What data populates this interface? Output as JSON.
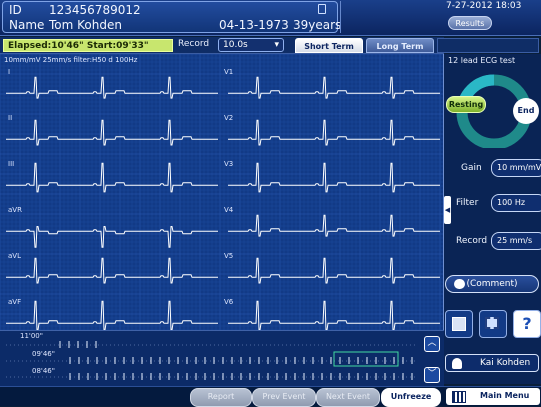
{
  "patient": {
    "id_label": "ID",
    "id_value": "123456789012",
    "name_label": "Name",
    "name_value": "Tom Kohden",
    "dob": "04-13-1973",
    "age": "39years"
  },
  "topbar": {
    "datetime": "7-27-2012 18:03",
    "results_label": "Results"
  },
  "status": {
    "elapsed_text": "Elapsed:10'46\"   Start:09'33\"",
    "record_label": "Record",
    "record_value": "10.0s"
  },
  "tabs": {
    "short_term": "Short Term",
    "long_term": "Long Term"
  },
  "ecg": {
    "settings_text": "10mm/mV 25mm/s filter:H50 d 100Hz",
    "leads_left": [
      "I",
      "II",
      "III",
      "aVR",
      "aVL",
      "aVF"
    ],
    "leads_right": [
      "V1",
      "V2",
      "V3",
      "V4",
      "V5",
      "V6"
    ]
  },
  "trend": {
    "t1": "11'00\"",
    "t2": "09'46\"",
    "t3": "08'46\""
  },
  "side": {
    "title": "12 lead ECG test",
    "resting_label": "Resting",
    "end_label": "End",
    "gain_label": "Gain",
    "gain_value": "10 mm/mV",
    "filter_label": "Filter",
    "filter_value": "100 Hz",
    "record_label": "Record",
    "record_value": "25  mm/s",
    "comment_label": "(Comment)",
    "user_name": "Kai Kohden"
  },
  "bottom": {
    "report": "Report",
    "prev_event": "Prev Event",
    "next_event": "Next Event",
    "unfreeze": "Unfreeze",
    "main_menu": "Main Menu"
  },
  "colors": {
    "accent_green": "#c8e66e",
    "panel_blue": "#123a86",
    "trace": "#ffffff",
    "event_marker": "#ff4a6a"
  }
}
